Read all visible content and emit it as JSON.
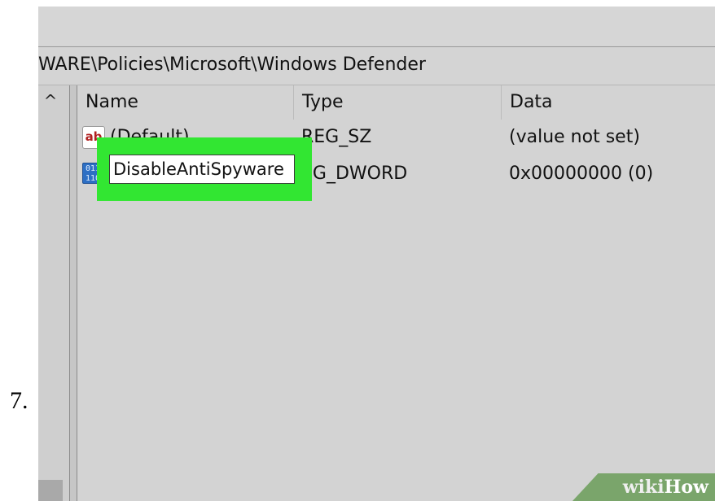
{
  "step": {
    "number": "7."
  },
  "regedit": {
    "address_path": "WARE\\Policies\\Microsoft\\Windows Defender",
    "scroll_up_glyph": "^",
    "columns": {
      "name": "Name",
      "type": "Type",
      "data": "Data"
    },
    "rows": [
      {
        "icon": "string-value-icon",
        "name": "(Default)",
        "type": "REG_SZ",
        "data": "(value not set)"
      },
      {
        "icon": "dword-value-icon",
        "name": "DisableAntiSpyware",
        "type": "EG_DWORD",
        "data": "0x00000000 (0)"
      }
    ],
    "rename_value": "DisableAntiSpyware",
    "string_icon_text": "ab",
    "dword_icon_text": "011\n110"
  },
  "watermark": {
    "wiki": "wiki",
    "how": "How"
  },
  "colors": {
    "highlight": "#32e632",
    "background": "#d3d3d3",
    "watermark": "#7aa56b"
  }
}
